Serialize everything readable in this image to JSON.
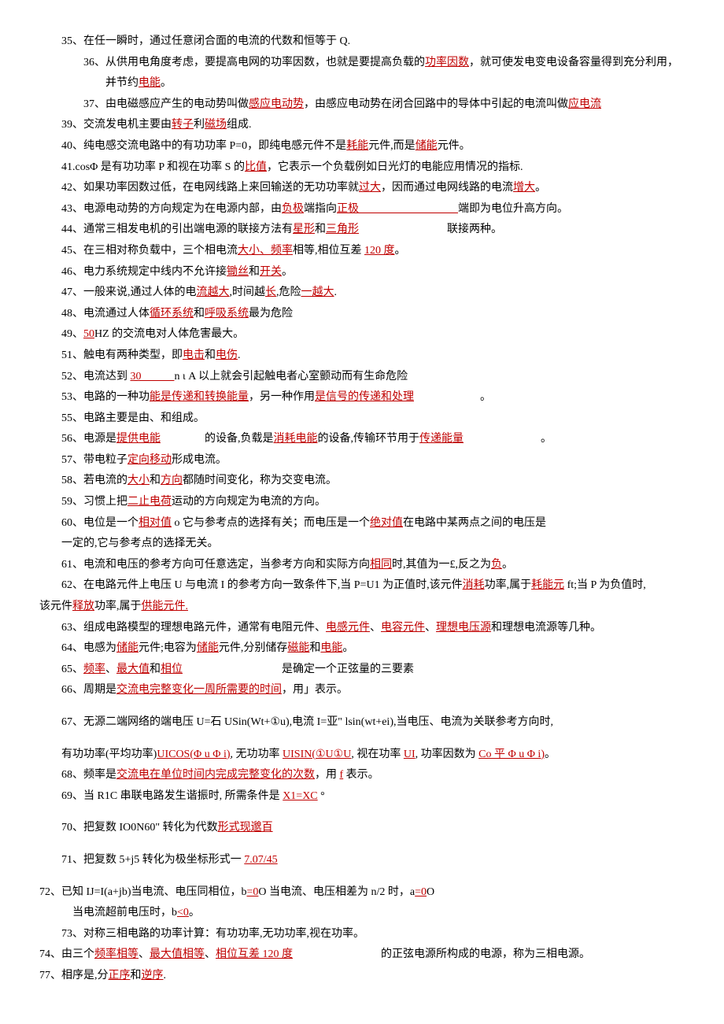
{
  "lines": [
    {
      "indent": "indent-1",
      "segments": [
        {
          "t": "35、在任一瞬时，通过任意闭合面的电流的代数和恒等于 Q."
        }
      ]
    },
    {
      "indent": "indent-2",
      "segments": [
        {
          "t": "36、从供用电角度考虑，要提高电网的功率因数，也就是要提高负载的"
        },
        {
          "t": "功率因数",
          "c": "red"
        },
        {
          "t": "，就可使发电变电设备容量得到充分利用，"
        }
      ]
    },
    {
      "indent": "indent-2",
      "segments": [
        {
          "t": "　　并节约"
        },
        {
          "t": "电能",
          "c": "red"
        },
        {
          "t": "。"
        }
      ]
    },
    {
      "indent": "indent-2",
      "segments": [
        {
          "t": "37、由电磁感应产生的电动势叫做"
        },
        {
          "t": "感应电动势",
          "c": "red"
        },
        {
          "t": "，由感应电动势在闭合回路中的导体中引起的电流叫做"
        },
        {
          "t": "应电流",
          "c": "red"
        }
      ]
    },
    {
      "indent": "indent-1",
      "segments": [
        {
          "t": "39、交流发电机主要由"
        },
        {
          "t": "转子",
          "c": "red"
        },
        {
          "t": "利"
        },
        {
          "t": "磁场",
          "c": "red"
        },
        {
          "t": "组成."
        }
      ]
    },
    {
      "indent": "indent-1",
      "segments": [
        {
          "t": "40、纯电感交流电路中的有功功率 P=0，即纯电感元件不是"
        },
        {
          "t": "耗能",
          "c": "red"
        },
        {
          "t": "元件,而是"
        },
        {
          "t": "储能",
          "c": "red"
        },
        {
          "t": "元件。"
        }
      ]
    },
    {
      "indent": "indent-1",
      "segments": [
        {
          "t": "41.cosΦ 是有功功率 P 和视在功率 S 的"
        },
        {
          "t": "比值",
          "c": "red"
        },
        {
          "t": "，它表示一个负载例如日光灯的电能应用情况的指标."
        }
      ]
    },
    {
      "indent": "indent-1",
      "segments": [
        {
          "t": "42、如果功率因数过低，在电网线路上来回输送的无功功率就"
        },
        {
          "t": "过大",
          "c": "red"
        },
        {
          "t": "，因而通过电网线路的电流"
        },
        {
          "t": "增大",
          "c": "red"
        },
        {
          "t": "。"
        }
      ]
    },
    {
      "indent": "indent-1",
      "segments": [
        {
          "t": "43、电源电动势的方向规定为在电源内部，由"
        },
        {
          "t": "负极",
          "c": "red"
        },
        {
          "t": "端指向"
        },
        {
          "t": "正极　　　　　　　　　",
          "c": "red"
        },
        {
          "t": "端即为电位升高方向。"
        }
      ]
    },
    {
      "indent": "indent-1",
      "segments": [
        {
          "t": "44、通常三相发电机的引出端电源的联接方法有"
        },
        {
          "t": "星形",
          "c": "red"
        },
        {
          "t": "和"
        },
        {
          "t": "三角形",
          "c": "red"
        },
        {
          "t": "　　　　　　　　联接两种。"
        }
      ]
    },
    {
      "indent": "indent-1",
      "segments": [
        {
          "t": "45、在三相对称负载中，三个相电流"
        },
        {
          "t": "大小、频率",
          "c": "red"
        },
        {
          "t": "相等,相位互差 "
        },
        {
          "t": "120 度",
          "c": "red"
        },
        {
          "t": "。"
        }
      ]
    },
    {
      "indent": "indent-1",
      "segments": [
        {
          "t": "46、电力系统规定中线内不允许接"
        },
        {
          "t": "锄丝",
          "c": "red"
        },
        {
          "t": "和"
        },
        {
          "t": "开关",
          "c": "red"
        },
        {
          "t": "。"
        }
      ]
    },
    {
      "indent": "indent-1",
      "segments": [
        {
          "t": "47、一般来说,通过人体的电"
        },
        {
          "t": "流越大",
          "c": "red"
        },
        {
          "t": ",时间越"
        },
        {
          "t": "长",
          "c": "red"
        },
        {
          "t": ",危险"
        },
        {
          "t": "一越大",
          "c": "red"
        },
        {
          "t": "."
        }
      ]
    },
    {
      "indent": "indent-1",
      "segments": [
        {
          "t": "48、电流通过人体"
        },
        {
          "t": "循环系统",
          "c": "red"
        },
        {
          "t": "和"
        },
        {
          "t": "呼吸系统",
          "c": "red"
        },
        {
          "t": "最为危险"
        }
      ]
    },
    {
      "indent": "indent-1",
      "segments": [
        {
          "t": "49、"
        },
        {
          "t": "50",
          "c": "red"
        },
        {
          "t": "HZ 的交流电对人体危害最大。"
        }
      ]
    },
    {
      "indent": "indent-1",
      "segments": [
        {
          "t": "51、触电有两种类型，即"
        },
        {
          "t": "电击",
          "c": "red"
        },
        {
          "t": "和"
        },
        {
          "t": "电伤",
          "c": "red"
        },
        {
          "t": "."
        }
      ]
    },
    {
      "indent": "indent-1",
      "segments": [
        {
          "t": "52、电流达到 "
        },
        {
          "t": "30　　　",
          "c": "red"
        },
        {
          "t": "n ι A 以上就会引起触电者心室颤动而有生命危险"
        }
      ]
    },
    {
      "indent": "indent-1",
      "segments": [
        {
          "t": "53、电路的一种功"
        },
        {
          "t": "能是传递和转换能量",
          "c": "red"
        },
        {
          "t": "，另一种作用"
        },
        {
          "t": "是信号的传递和处理",
          "c": "red"
        },
        {
          "t": "　　　　　　。"
        }
      ]
    },
    {
      "indent": "indent-1",
      "segments": [
        {
          "t": "55、电路主要是由、和组成。"
        }
      ]
    },
    {
      "indent": "indent-1",
      "segments": [
        {
          "t": "56、电源是"
        },
        {
          "t": "提供电能",
          "c": "red"
        },
        {
          "t": "　　　　的设备,负载是"
        },
        {
          "t": "消耗电能",
          "c": "red"
        },
        {
          "t": "的设备,传输环节用于"
        },
        {
          "t": "传递能量",
          "c": "red"
        },
        {
          "t": "　　　　　　　。"
        }
      ]
    },
    {
      "indent": "indent-1",
      "segments": [
        {
          "t": "57、带电粒子"
        },
        {
          "t": "定向移动",
          "c": "red"
        },
        {
          "t": "形成电流。"
        }
      ]
    },
    {
      "indent": "indent-1",
      "segments": [
        {
          "t": "58、若电流的"
        },
        {
          "t": "大小",
          "c": "red"
        },
        {
          "t": "和"
        },
        {
          "t": "方向",
          "c": "red"
        },
        {
          "t": "都随时间变化，称为交变电流。"
        }
      ]
    },
    {
      "indent": "indent-1",
      "segments": [
        {
          "t": "59、习惯上把"
        },
        {
          "t": "二止电荷",
          "c": "red"
        },
        {
          "t": "运动的方向规定为电流的方向。"
        }
      ]
    },
    {
      "indent": "indent-1",
      "segments": [
        {
          "t": "60、电位是一个"
        },
        {
          "t": "相对值",
          "c": "red"
        },
        {
          "t": " o 它与参考点的选择有关；而电压是一个"
        },
        {
          "t": "绝对值",
          "c": "red"
        },
        {
          "t": "在电路中某两点之间的电压是"
        }
      ]
    },
    {
      "indent": "indent-1",
      "segments": [
        {
          "t": "一定的,它与参考点的选择无关。"
        }
      ]
    },
    {
      "indent": "indent-1",
      "segments": [
        {
          "t": "61、电流和电压的参考方向可任意选定，当参考方向和实际方向"
        },
        {
          "t": "相同",
          "c": "red"
        },
        {
          "t": "时,其值为一£,反之为"
        },
        {
          "t": "负",
          "c": "red"
        },
        {
          "t": "。"
        }
      ]
    },
    {
      "indent": "indent-1",
      "segments": [
        {
          "t": "62、在电路元件上电压 U 与电流 I 的参考方向一致条件下,当 P=U1 为正值时,该元件"
        },
        {
          "t": "消耗",
          "c": "red"
        },
        {
          "t": "功率,属于"
        },
        {
          "t": "耗能元",
          "c": "red"
        },
        {
          "t": " ft;当 P 为负值时,"
        }
      ]
    },
    {
      "indent": "indent-0",
      "segments": [
        {
          "t": "该元件"
        },
        {
          "t": "释放",
          "c": "red"
        },
        {
          "t": "功率,属于"
        },
        {
          "t": "供能元件.",
          "c": "red"
        }
      ]
    },
    {
      "indent": "indent-1",
      "segments": [
        {
          "t": "63、组成电路模型的理想电路元件，通常有电阻元件、"
        },
        {
          "t": "电感元件",
          "c": "red"
        },
        {
          "t": "、"
        },
        {
          "t": "电容元件",
          "c": "red"
        },
        {
          "t": "、"
        },
        {
          "t": "理想电压源",
          "c": "red"
        },
        {
          "t": "和理想电流源等几种。"
        }
      ]
    },
    {
      "indent": "indent-1",
      "segments": [
        {
          "t": "64、电感为"
        },
        {
          "t": "储能",
          "c": "red"
        },
        {
          "t": "元件;电容为"
        },
        {
          "t": "储能",
          "c": "red"
        },
        {
          "t": "元件,分别储存"
        },
        {
          "t": "磁能",
          "c": "red"
        },
        {
          "t": "和"
        },
        {
          "t": "电能",
          "c": "red"
        },
        {
          "t": "。"
        }
      ]
    },
    {
      "indent": "indent-1",
      "segments": [
        {
          "t": "65、"
        },
        {
          "t": "频率",
          "c": "red"
        },
        {
          "t": "、"
        },
        {
          "t": "最大值",
          "c": "red"
        },
        {
          "t": "和"
        },
        {
          "t": "相位",
          "c": "red"
        },
        {
          "t": "　　　　　　　　　是确定一个正弦量的三要素"
        }
      ]
    },
    {
      "indent": "indent-1",
      "segments": [
        {
          "t": "66、周期是"
        },
        {
          "t": "交流电完整变化一周所需要的时间",
          "c": "red"
        },
        {
          "t": "，用」表示。"
        }
      ]
    },
    {
      "indent": "",
      "segments": [],
      "blank": true
    },
    {
      "indent": "indent-1",
      "segments": [
        {
          "t": "67、无源二端网络的端电压 U=石 USin(Wt+①u),电流 I=亚\" lsin(wt+ei),当电压、电流为关联参考方向时,"
        }
      ]
    },
    {
      "indent": "",
      "segments": [],
      "blank": true
    },
    {
      "indent": "indent-1",
      "segments": [
        {
          "t": "有功功率(平均功率)"
        },
        {
          "t": "UICOS(Φ u Φ i)",
          "c": "red"
        },
        {
          "t": ", 无功功率 "
        },
        {
          "t": "UISIN(①U①U",
          "c": "red"
        },
        {
          "t": ", 视在功率 "
        },
        {
          "t": "UI",
          "c": "red"
        },
        {
          "t": ", 功率因数为 "
        },
        {
          "t": "Co 平 Φ u Φ i)",
          "c": "red"
        },
        {
          "t": "。"
        }
      ]
    },
    {
      "indent": "indent-1",
      "segments": [
        {
          "t": "68、频率是"
        },
        {
          "t": "交流电在单位时间内完成完整变化的次数",
          "c": "red"
        },
        {
          "t": "，用 "
        },
        {
          "t": "f",
          "c": "red"
        },
        {
          "t": " 表示。"
        }
      ]
    },
    {
      "indent": "indent-1",
      "segments": [
        {
          "t": "69、当 R1C 串联电路发生谐振时, 所需条件是 "
        },
        {
          "t": "X1=XC",
          "c": "red"
        },
        {
          "t": " °"
        }
      ]
    },
    {
      "indent": "",
      "segments": [],
      "blank": true
    },
    {
      "indent": "indent-1",
      "segments": [
        {
          "t": "70、把复数 IO0N60\" 转化为代数"
        },
        {
          "t": "形式现邈百",
          "c": "red"
        }
      ]
    },
    {
      "indent": "",
      "segments": [],
      "blank": true
    },
    {
      "indent": "indent-1",
      "segments": [
        {
          "t": "71、把复数 5+j5 转化为极坐标形式一 "
        },
        {
          "t": "7.07/45",
          "c": "red"
        }
      ]
    },
    {
      "indent": "",
      "segments": [],
      "blank": true
    },
    {
      "indent": "indent-0",
      "segments": [
        {
          "t": "72、已知 IJ=I(a+jb)当电流、电压同相位，b"
        },
        {
          "t": "=0",
          "c": "red"
        },
        {
          "t": "O 当电流、电压相差为 n/2 时，a"
        },
        {
          "t": "=0",
          "c": "red"
        },
        {
          "t": "O"
        }
      ]
    },
    {
      "indent": "indent-3",
      "segments": [
        {
          "t": "当电流超前电压时，b"
        },
        {
          "t": "<0",
          "c": "red"
        },
        {
          "t": "。"
        }
      ]
    },
    {
      "indent": "indent-1",
      "segments": [
        {
          "t": "73、对称三相电路的功率计算：有功功率,无功功率,视在功率。"
        }
      ]
    },
    {
      "indent": "indent-0",
      "segments": [
        {
          "t": "74、由三个"
        },
        {
          "t": "频率相等",
          "c": "red"
        },
        {
          "t": "、"
        },
        {
          "t": "最大值相等",
          "c": "red"
        },
        {
          "t": "、"
        },
        {
          "t": "相位互差 120 度",
          "c": "red"
        },
        {
          "t": "　　　　　　　　的正弦电源所构成的电源，称为三相电源。"
        }
      ]
    },
    {
      "indent": "indent-0",
      "segments": [
        {
          "t": "77、相序是,分"
        },
        {
          "t": "正序",
          "c": "red"
        },
        {
          "t": "和"
        },
        {
          "t": "逆序",
          "c": "red"
        },
        {
          "t": "."
        }
      ]
    }
  ]
}
